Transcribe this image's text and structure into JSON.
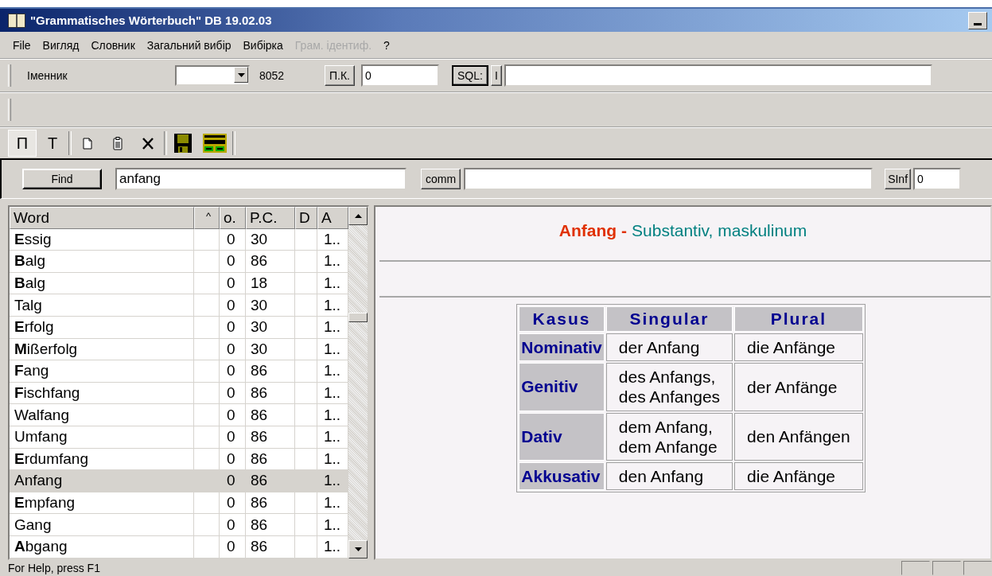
{
  "window": {
    "title": "\"Grammatisches Wörterbuch\" DB 19.02.03"
  },
  "menu": [
    {
      "label": "File",
      "disabled": false
    },
    {
      "label": "Вигляд",
      "disabled": false
    },
    {
      "label": "Словник",
      "disabled": false
    },
    {
      "label": "Загальний вибір",
      "disabled": false
    },
    {
      "label": "Вибірка",
      "disabled": false
    },
    {
      "label": "Грам. ідентиф.",
      "disabled": true
    },
    {
      "label": "?",
      "disabled": false
    }
  ],
  "toolbar": {
    "part_of_speech": "Іменник",
    "count": "8052",
    "pk_button": "П.К.",
    "pk_value": "0",
    "sql_button": "SQL:",
    "i_button": "I"
  },
  "tools": [
    {
      "kind": "letter",
      "label": "П",
      "selected": true
    },
    {
      "kind": "letter",
      "label": "Т",
      "selected": false
    },
    {
      "kind": "new"
    },
    {
      "kind": "clipboard"
    },
    {
      "kind": "delete"
    },
    {
      "kind": "save"
    },
    {
      "kind": "keys"
    }
  ],
  "find": {
    "button": "Find",
    "value": "anfang",
    "comm_button": "comm",
    "sinf_button": "SInf",
    "sinf_value": "0"
  },
  "table": {
    "columns": [
      "Word",
      "^",
      "o.",
      "P.C.",
      "D",
      "A"
    ],
    "rows": [
      {
        "word": "**E**ssig",
        "o": "0",
        "pc": "30",
        "a": "1..",
        "selected": false
      },
      {
        "word": "**B**alg",
        "o": "0",
        "pc": "86",
        "a": "1..",
        "selected": false
      },
      {
        "word": "**B**alg",
        "o": "0",
        "pc": "18",
        "a": "1..",
        "selected": false
      },
      {
        "word": "Talg",
        "o": "0",
        "pc": "30",
        "a": "1..",
        "selected": false
      },
      {
        "word": "**E**rfolg",
        "o": "0",
        "pc": "30",
        "a": "1..",
        "selected": false
      },
      {
        "word": "**M**ißerfolg",
        "o": "0",
        "pc": "30",
        "a": "1..",
        "selected": false
      },
      {
        "word": "**F**ang",
        "o": "0",
        "pc": "86",
        "a": "1..",
        "selected": false
      },
      {
        "word": "**F**ischfang",
        "o": "0",
        "pc": "86",
        "a": "1..",
        "selected": false
      },
      {
        "word": "Walfang",
        "o": "0",
        "pc": "86",
        "a": "1..",
        "selected": false
      },
      {
        "word": "Umfang",
        "o": "0",
        "pc": "86",
        "a": "1..",
        "selected": false
      },
      {
        "word": "**E**rdumfang",
        "o": "0",
        "pc": "86",
        "a": "1..",
        "selected": false
      },
      {
        "word": "Anfang",
        "o": "0",
        "pc": "86",
        "a": "1..",
        "selected": true
      },
      {
        "word": "**E**mpfang",
        "o": "0",
        "pc": "86",
        "a": "1..",
        "selected": false
      },
      {
        "word": "Gang",
        "o": "0",
        "pc": "86",
        "a": "1..",
        "selected": false
      },
      {
        "word": "**A**bgang",
        "o": "0",
        "pc": "86",
        "a": "1..",
        "selected": false
      }
    ]
  },
  "entry": {
    "word": "Anfang",
    "separator": "-",
    "grammar": "Substantiv, maskulinum",
    "columns": [
      "Kasus",
      "Singular",
      "Plural"
    ],
    "rows": [
      {
        "case": "Nominativ",
        "singular": "der Anfang",
        "plural": "die Anfänge"
      },
      {
        "case": "Genitiv",
        "singular": "des Anfangs,\ndes Anfanges",
        "plural": "der Anfänge"
      },
      {
        "case": "Dativ",
        "singular": "dem Anfang,\ndem Anfange",
        "plural": "den Anfängen"
      },
      {
        "case": "Akkusativ",
        "singular": "den Anfang",
        "plural": "die Anfänge"
      }
    ]
  },
  "status_bar": {
    "text": "For Help, press F1"
  }
}
